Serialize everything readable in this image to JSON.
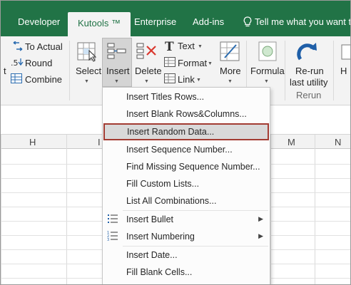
{
  "tabs": [
    "Developer",
    "Kutools ™",
    "Enterprise",
    "Add-ins"
  ],
  "tell_me": "Tell me what you want t",
  "ribbon": {
    "left_partial": "t",
    "to_actual": "To Actual",
    "round": "Round",
    "combine": "Combine",
    "select": "Select",
    "insert": "Insert",
    "delete": "Delete",
    "text": "Text",
    "format": "Format",
    "link": "Link",
    "more": "More",
    "formula": "Formula",
    "rerun_line1": "Re-run",
    "rerun_line2": "last utility",
    "rerun_group": "Rerun",
    "right_partial": "H"
  },
  "columns": [
    "H",
    "I",
    "M",
    "N"
  ],
  "menu": {
    "items": [
      "Insert Titles Rows...",
      "Insert Blank Rows&Columns...",
      "Insert Random Data...",
      "Insert Sequence Number...",
      "Find Missing Sequence Number...",
      "Fill Custom Lists...",
      "List All Combinations...",
      "Insert Bullet",
      "Insert Numbering",
      "Insert Date...",
      "Fill Blank Cells..."
    ],
    "highlighted_index": 2
  },
  "colors": {
    "tab_bar": "#217346",
    "ribbon_bg": "#f3f3f3",
    "highlight_border": "#a23b32",
    "highlight_fill": "#d9d9d9"
  }
}
